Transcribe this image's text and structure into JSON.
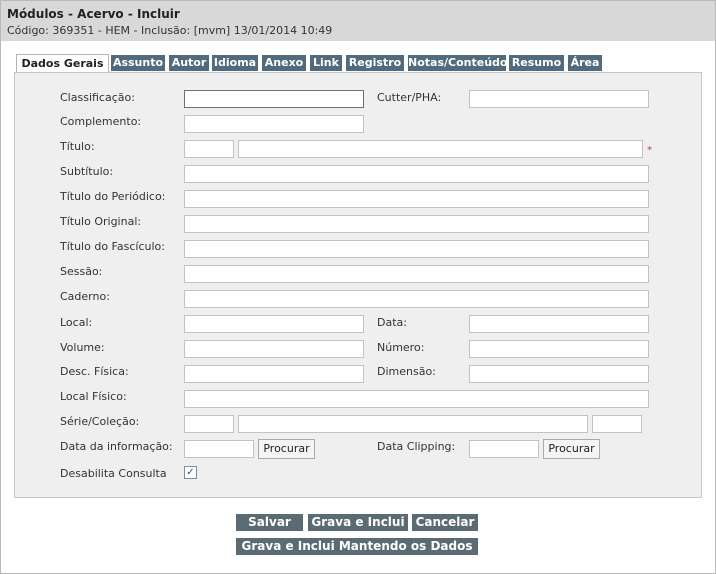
{
  "header": {
    "title": "Módulos - Acervo - Incluir",
    "info": "Código: 369351 - HEM - Inclusão: [mvm] 13/01/2014 10:49"
  },
  "tabs": [
    "Dados Gerais",
    "Assunto",
    "Autor",
    "Idioma",
    "Anexo",
    "Link",
    "Registro",
    "Notas/Conteúdo",
    "Resumo",
    "Área"
  ],
  "form": {
    "classificacao": "Classificação:",
    "cutter": "Cutter/PHA:",
    "complemento": "Complemento:",
    "titulo": "Título:",
    "required_mark": "*",
    "subtitulo": "Subtítulo:",
    "titulo_periodico": "Título do Periódico:",
    "titulo_original": "Título Original:",
    "titulo_fasciculo": "Título do Fascículo:",
    "sessao": "Sessão:",
    "caderno": "Caderno:",
    "local": "Local:",
    "data": "Data:",
    "volume": "Volume:",
    "numero": "Número:",
    "desc_fisica": "Desc. Física:",
    "dimensao": "Dimensão:",
    "local_fisico": "Local Físico:",
    "serie_colecao": "Série/Coleção:",
    "data_informacao": "Data da informação:",
    "procurar": "Procurar",
    "data_clipping": "Data Clipping:",
    "desabilita_consulta": "Desabilita Consulta",
    "check_mark": "✓"
  },
  "actions": {
    "salvar": "Salvar",
    "grava_inclui": "Grava e Inclui",
    "cancelar": "Cancelar",
    "grava_inclui_mantendo": "Grava e Inclui Mantendo os Dados"
  }
}
